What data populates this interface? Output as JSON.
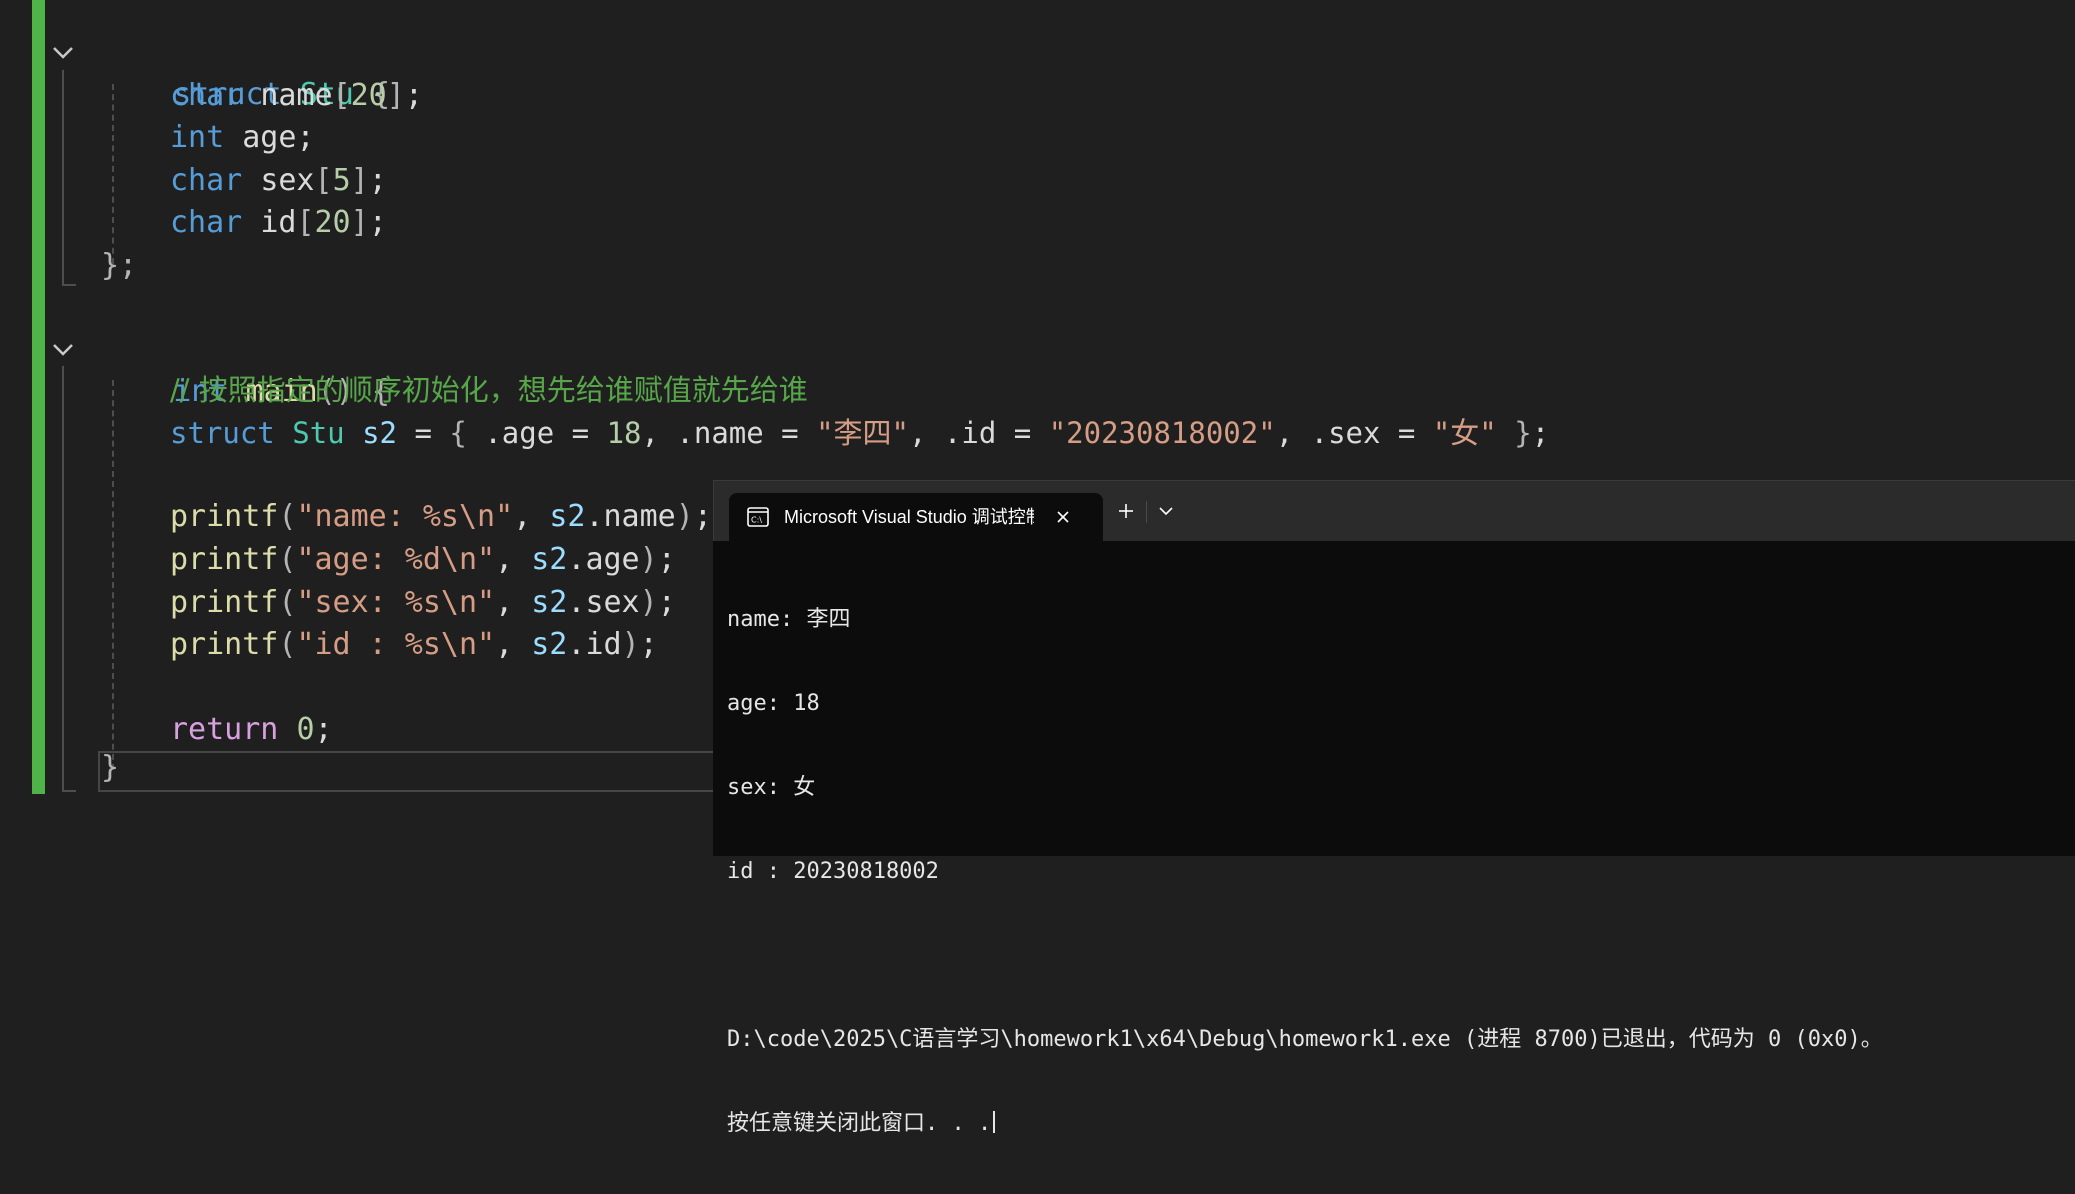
{
  "editor": {
    "struct_line": {
      "kw": "struct",
      "name": "Stu",
      "brace": "{"
    },
    "fields": [
      {
        "type": "char",
        "name": "name",
        "size": "20"
      },
      {
        "type": "int",
        "name": "age",
        "size": ""
      },
      {
        "type": "char",
        "name": "sex",
        "size": "5"
      },
      {
        "type": "char",
        "name": "id",
        "size": "20"
      }
    ],
    "struct_close": "};",
    "main_line": {
      "type": "int",
      "name": "main",
      "rest": "() {"
    },
    "comment": "// 按照指定的顺序初始化，想先给谁赋值就先给谁",
    "init": {
      "kw": "struct",
      "type": "Stu",
      "var": "s2",
      "age": "18",
      "name": "\"李四\"",
      "id": "\"20230818002\"",
      "sex": "\"女\""
    },
    "printfs": [
      {
        "fmt": "\"name: %s\\n\"",
        "member": "name"
      },
      {
        "fmt": "\"age: %d\\n\"",
        "member": "age"
      },
      {
        "fmt": "\"sex: %s\\n\"",
        "member": "sex"
      },
      {
        "fmt": "\"id : %s\\n\"",
        "member": "id"
      }
    ],
    "return_line": {
      "kw": "return",
      "value": "0"
    },
    "main_close": "}"
  },
  "terminal": {
    "tab_title": "Microsoft Visual Studio 调试控制台",
    "icons": {
      "tab": "console-icon",
      "close": "close-icon",
      "new": "plus-icon",
      "dropdown": "chevron-down-icon"
    },
    "lines": [
      "name: 李四",
      "age: 18",
      "sex: 女",
      "id : 20230818002",
      "",
      "D:\\code\\2025\\C语言学习\\homework1\\x64\\Debug\\homework1.exe (进程 8700)已退出，代码为 0 (0x0)。",
      "按任意键关闭此窗口. . ."
    ]
  },
  "colors": {
    "editor_bg": "#1f1f1f",
    "change_bar": "#4fb347",
    "keyword": "#569cd6",
    "type": "#4ec9b0",
    "string": "#d69d85",
    "comment": "#57a64a",
    "terminal_bg": "#0c0c0c"
  }
}
